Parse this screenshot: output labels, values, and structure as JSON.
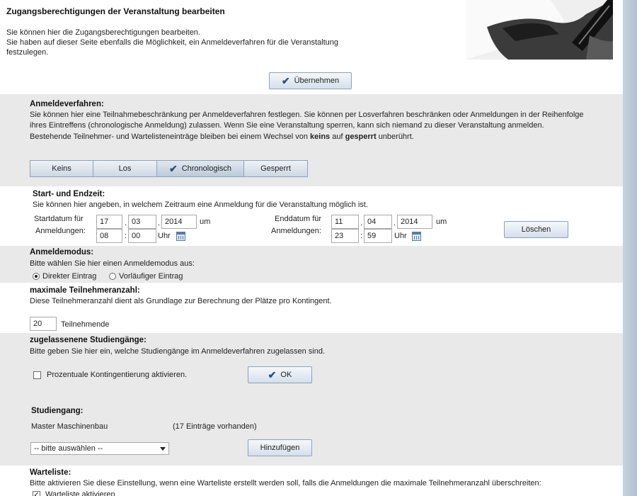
{
  "header": {
    "title": "Zugangsberechtigungen der Veranstaltung bearbeiten",
    "line1": "Sie können hier die Zugangsberechtigungen bearbeiten.",
    "line2": "Sie haben auf dieser Seite ebenfalls die Möglichkeit, ein Anmeldeverfahren für die Veranstaltung",
    "line3": "festzulegen."
  },
  "apply_button": "Übernehmen",
  "anmeldeverfahren": {
    "heading": "Anmeldeverfahren:",
    "line1": "Sie können hier eine Teilnahmebeschränkung per Anmeldeverfahren festlegen. Sie können per Losverfahren beschränken oder Anmeldungen in der Reihenfolge",
    "line2": "ihres Eintreffens (chronologische Anmeldung) zulassen. Wenn Sie eine Veranstaltung sperren, kann sich niemand zu dieser Veranstaltung anmelden.",
    "line3_a": "Bestehende Teilnehmer- und Wartelisteneinträge bleiben bei einem Wechsel von ",
    "line3_keins": "keins",
    "line3_b": " auf ",
    "line3_gesperrt": "gesperrt",
    "line3_c": " unberührt.",
    "options": [
      "Keins",
      "Los",
      "Chronologisch",
      "Gesperrt"
    ],
    "selected": "Chronologisch"
  },
  "zeit": {
    "heading": "Start- und Endzeit:",
    "description": "Sie können hier angeben, in welchem Zeitraum eine Anmeldung für die Veranstaltung möglich ist.",
    "start_label_1": "Startdatum für",
    "start_label_2": "Anmeldungen:",
    "start_day": "17",
    "start_month": "03",
    "start_year": "2014",
    "start_hour": "08",
    "start_minute": "00",
    "end_label_1": "Enddatum für",
    "end_label_2": "Anmeldungen:",
    "end_day": "11",
    "end_month": "04",
    "end_year": "2014",
    "end_hour": "23",
    "end_minute": "59",
    "dot": ".",
    "colon": ":",
    "um": "um",
    "uhr": "Uhr",
    "delete_button": "Löschen"
  },
  "anmeldemodus": {
    "heading": "Anmeldemodus:",
    "description": "Bitte wählen Sie hier einen Anmeldemodus aus:",
    "option_direct": "Direkter Eintrag",
    "option_provisional": "Vorläufiger Eintrag",
    "selected": "Direkter Eintrag"
  },
  "teilnehmer": {
    "heading": "maximale Teilnehmeranzahl:",
    "description": "Diese Teilnehmeranzahl dient als Grundlage zur Berechnung der Plätze pro Kontingent.",
    "value": "20",
    "unit": "Teilnehmende"
  },
  "studiengaenge": {
    "heading": "zugelassenene Studiengänge:",
    "description": "Bitte geben Sie hier ein, welche Studiengänge im Anmeldeverfahren zugelassen sind.",
    "checkbox_label": "Prozentuale Kontingentierung aktivieren.",
    "ok_button": "OK",
    "sub_heading": "Studiengang:",
    "program_name": "Master Maschinenbau",
    "program_count": "(17 Einträge vorhanden)",
    "select_value": "-- bitte auswählen --",
    "add_button": "Hinzufügen"
  },
  "warteliste": {
    "heading": "Warteliste:",
    "description": "Bitte aktivieren Sie diese Einstellung, wenn eine Warteliste erstellt werden soll, falls die Anmeldungen die maximale Teilnehmeranzahl überschreiten:",
    "checkbox_label": "Warteliste aktivieren"
  },
  "colors": {
    "page_bg": "#ffffff",
    "section_grey": "#e9e9e9",
    "button_border": "#8ea2b8",
    "accent": "#2a4f80"
  }
}
